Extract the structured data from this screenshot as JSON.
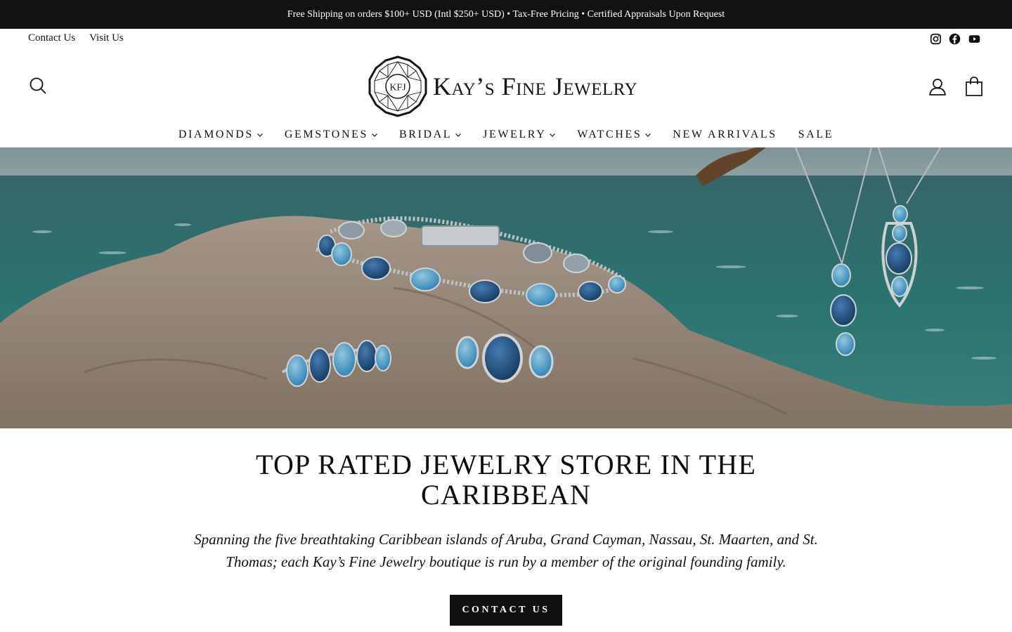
{
  "announcement": "Free Shipping on orders $100+ USD (Intl $250+ USD) • Tax-Free Pricing • Certified Appraisals Upon Request",
  "utility_links": {
    "contact": "Contact Us",
    "visit": "Visit Us"
  },
  "social_icons": [
    "instagram-icon",
    "facebook-icon",
    "youtube-icon"
  ],
  "header_icons": [
    "search-icon",
    "account-icon",
    "cart-icon"
  ],
  "logo": {
    "monogram": "KFJ",
    "name": "Kay’s Fine Jewelry"
  },
  "nav": {
    "items": [
      {
        "label": "DIAMONDS",
        "has_dropdown": true
      },
      {
        "label": "GEMSTONES",
        "has_dropdown": true
      },
      {
        "label": "BRIDAL",
        "has_dropdown": true
      },
      {
        "label": "JEWELRY",
        "has_dropdown": true
      },
      {
        "label": "WATCHES",
        "has_dropdown": true
      },
      {
        "label": "NEW ARRIVALS",
        "has_dropdown": false
      },
      {
        "label": "SALE",
        "has_dropdown": false
      }
    ]
  },
  "hero": {
    "subject": "blue topaz bracelet, rings and pendants on rock by the sea"
  },
  "intro": {
    "heading": "TOP RATED JEWELRY STORE IN THE CARIBBEAN",
    "body": "Spanning the five breathtaking Caribbean islands of Aruba, Grand Cayman, Nassau, St. Maarten, and St. Thomas; each Kay’s Fine Jewelry boutique is run by a member of the original founding family.",
    "cta": "CONTACT US"
  },
  "colors": {
    "announcement_bg": "#121212",
    "text": "#111111",
    "button_bg": "#111111",
    "sea": "#2f6f70",
    "gem_dark": "#1e4d80",
    "gem_light": "#4aa8d8"
  }
}
